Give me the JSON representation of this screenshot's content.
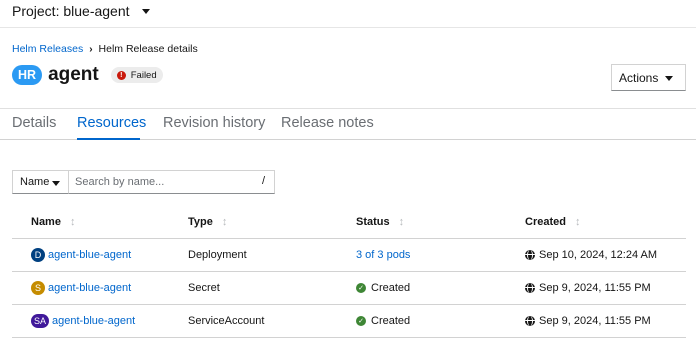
{
  "project": {
    "label": "Project: blue-agent"
  },
  "breadcrumb": {
    "root": "Helm Releases",
    "separator": "›",
    "current": "Helm Release details"
  },
  "header": {
    "badge": "HR",
    "title": "agent",
    "status": "Failed",
    "status_icon": "error-circle-icon",
    "actions_label": "Actions"
  },
  "tabs": [
    {
      "label": "Details"
    },
    {
      "label": "Resources",
      "active": true
    },
    {
      "label": "Revision history"
    },
    {
      "label": "Release notes"
    }
  ],
  "filter": {
    "select_label": "Name",
    "placeholder": "Search by name...",
    "shortcut": "/"
  },
  "table": {
    "columns": [
      "Name",
      "Type",
      "Status",
      "Created"
    ],
    "sort_icon": "↕",
    "rows": [
      {
        "badge": "D",
        "badge_color": "#004080",
        "name": "agent-blue-agent",
        "type": "Deployment",
        "status": "3 of 3 pods",
        "status_kind": "link",
        "created": "Sep 10, 2024, 12:24 AM"
      },
      {
        "badge": "S",
        "badge_color": "#c58c00",
        "name": "agent-blue-agent",
        "type": "Secret",
        "status": "Created",
        "status_kind": "ok",
        "created": "Sep 9, 2024, 11:55 PM"
      },
      {
        "badge": "SA",
        "badge_color": "#40199a",
        "name": "agent-blue-agent",
        "type": "ServiceAccount",
        "status": "Created",
        "status_kind": "ok",
        "created": "Sep 9, 2024, 11:55 PM"
      }
    ]
  },
  "colors": {
    "link": "#0066cc",
    "hr_badge": "#2b9af3",
    "danger": "#c9190b",
    "success": "#3e8635"
  }
}
